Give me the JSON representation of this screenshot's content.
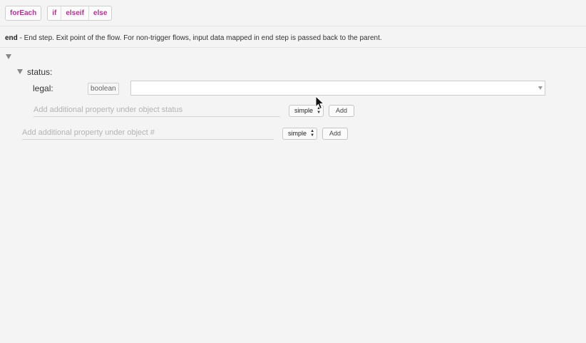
{
  "toolbar": {
    "foreach_label": "forEach",
    "if_label": "if",
    "elseif_label": "elseif",
    "else_label": "else"
  },
  "step": {
    "name": "end",
    "description": " - End step. Exit point of the flow. For non-trigger flows, input data mapped in end step is passed back to the parent."
  },
  "schema": {
    "object_status": {
      "label": "status:",
      "property": {
        "label": "legal:",
        "type": "boolean",
        "value": ""
      },
      "add_placeholder": "Add additional property under object status",
      "type_select": "simple",
      "add_label": "Add"
    },
    "root": {
      "add_placeholder": "Add additional property under object #",
      "type_select": "simple",
      "add_label": "Add"
    }
  },
  "icons": {
    "caret": "caret-down-icon",
    "stepper": "up-down-arrows-icon",
    "cursor": "mouse-pointer-icon"
  },
  "colors": {
    "accent": "#b0358f",
    "background": "#f4f4f4"
  }
}
